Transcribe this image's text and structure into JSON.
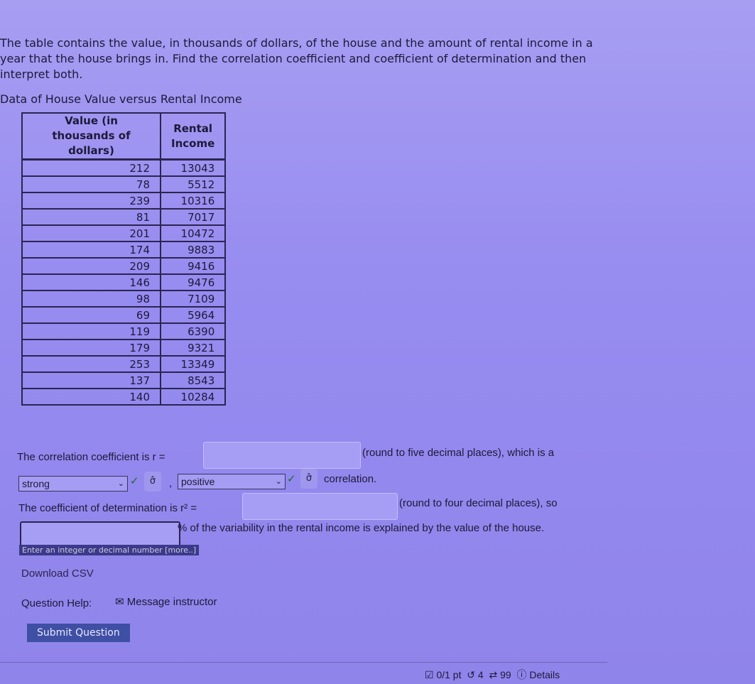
{
  "question": "The table contains the value, in thousands of dollars, of the house and the amount of rental income in a year that the house brings in. Find the correlation coefficient and coefficient of determination and then interpret both.",
  "table_caption": "Data of House Value versus Rental Income",
  "table": {
    "headers": [
      "Value (in thousands of dollars)",
      "Rental Income"
    ],
    "rows": [
      [
        "212",
        "13043"
      ],
      [
        "78",
        "5512"
      ],
      [
        "239",
        "10316"
      ],
      [
        "81",
        "7017"
      ],
      [
        "201",
        "10472"
      ],
      [
        "174",
        "9883"
      ],
      [
        "209",
        "9416"
      ],
      [
        "146",
        "9476"
      ],
      [
        "98",
        "7109"
      ],
      [
        "69",
        "5964"
      ],
      [
        "119",
        "6390"
      ],
      [
        "179",
        "9321"
      ],
      [
        "253",
        "13349"
      ],
      [
        "137",
        "8543"
      ],
      [
        "140",
        "10284"
      ]
    ]
  },
  "r_prefix": "The correlation coefficient is r =",
  "r_suffix": "(round to five decimal places), which is a",
  "r_value": "",
  "strength_select": "strong",
  "direction_select": "positive",
  "comma": ",",
  "correlation_word": "correlation.",
  "r2_prefix": "The coefficient of determination is r² =",
  "r2_suffix": "(round to four decimal places), so",
  "r2_value": "",
  "pct_suffix": "% of the variability in the rental income is explained by the value of the house.",
  "pct_value": "",
  "tip": "Enter an integer or decimal number [more..]",
  "download": "Download CSV",
  "help_label": "Question Help:",
  "message": "Message instructor",
  "submit": "Submit Question",
  "footer": {
    "score": "0/1 pt",
    "retries": "4",
    "attempts": "99",
    "details": "Details"
  },
  "check_color": "#1f6b2a"
}
